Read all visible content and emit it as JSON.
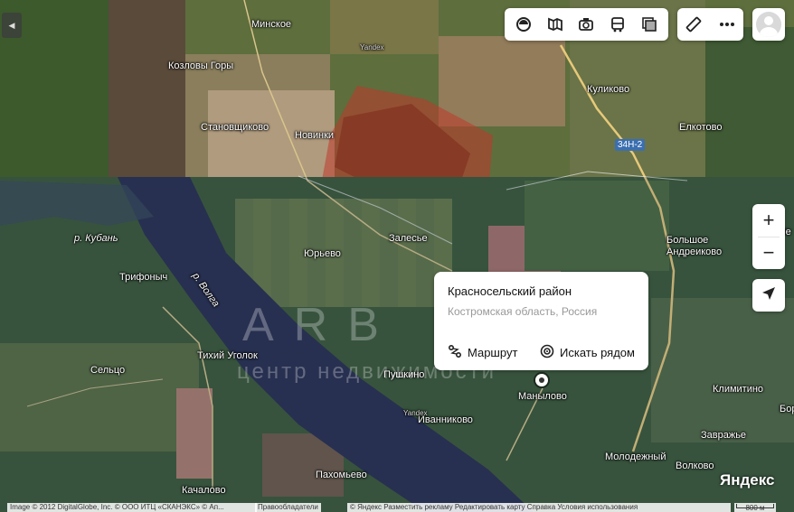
{
  "map": {
    "places": [
      {
        "id": "minskoe",
        "label": "Минское"
      },
      {
        "id": "kozlovy-gory",
        "label": "Козловы Горы"
      },
      {
        "id": "stanovshchikovo",
        "label": "Становщиково"
      },
      {
        "id": "novinki",
        "label": "Новинки"
      },
      {
        "id": "kulikovo",
        "label": "Куликово"
      },
      {
        "id": "elkotovo",
        "label": "Елкотово"
      },
      {
        "id": "zalese",
        "label": "Залесье"
      },
      {
        "id": "yurevo",
        "label": "Юрьево"
      },
      {
        "id": "bolshoe-andreikovo",
        "label": "Большое\nАндреиково"
      },
      {
        "id": "trifonych",
        "label": "Трифоныч"
      },
      {
        "id": "tikhiy-ugolok",
        "label": "Тихий Уголок"
      },
      {
        "id": "seltso",
        "label": "Сельцо"
      },
      {
        "id": "pushkino",
        "label": "Пушкино"
      },
      {
        "id": "manylovo",
        "label": "Манылово"
      },
      {
        "id": "ivannikovo",
        "label": "Иванниково"
      },
      {
        "id": "klimitino",
        "label": "Климитино"
      },
      {
        "id": "zavrazhe",
        "label": "Завражье"
      },
      {
        "id": "molodezhny",
        "label": "Молодежный"
      },
      {
        "id": "volkovo",
        "label": "Волково"
      },
      {
        "id": "pakhomevo",
        "label": "Пахомьево"
      },
      {
        "id": "kachalovo",
        "label": "Качалово"
      },
      {
        "id": "ze",
        "label": "Зе"
      },
      {
        "id": "bor",
        "label": "Бор"
      }
    ],
    "rivers": {
      "kuban": "р. Кубань",
      "volga": "р. Волга"
    },
    "road_badge": "34Н-2",
    "yandex_marks": [
      "Yandex",
      "Yandex"
    ]
  },
  "toolbar": {
    "icons": [
      "layers-icon",
      "map-book-icon",
      "camera-icon",
      "bus-icon",
      "transparency-icon"
    ],
    "tools": [
      "ruler-icon",
      "more-icon"
    ]
  },
  "zoom": {
    "in": "+",
    "out": "−"
  },
  "popup": {
    "title": "Красносельский район",
    "subtitle": "Костромская область, Россия",
    "route_label": "Маршрут",
    "nearby_label": "Искать рядом"
  },
  "watermark": {
    "big": "ARB",
    "small": "центр недвижимости"
  },
  "logo": "Яндекс",
  "attribution": {
    "left": "Image © 2012 DigitalGlobe, Inc. © ООО ИТЦ «СКАНЭКС» © Ап...",
    "rightsholders": "Правообладатели",
    "links": "© Яндекс   Разместить рекламу   Редактировать карту   Справка   Условия использования"
  },
  "scale": "800 м",
  "colors": {
    "highlight": "#c0392b",
    "panel": "#ffffff",
    "watermark": "rgba(255,255,255,0.28)"
  }
}
